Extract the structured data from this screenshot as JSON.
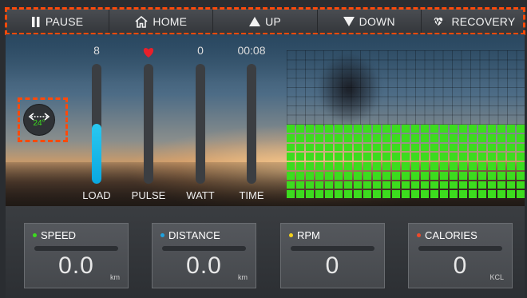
{
  "toolbar": {
    "pause_label": "PAUSE",
    "home_label": "HOME",
    "up_label": "UP",
    "down_label": "DOWN",
    "recovery_label": "RECOVERY"
  },
  "meters": {
    "load": {
      "value": "8",
      "label": "LOAD",
      "level": 0.5
    },
    "pulse": {
      "label": "PULSE"
    },
    "watt": {
      "value": "0",
      "label": "WATT"
    },
    "time": {
      "value": "00:08",
      "label": "TIME"
    }
  },
  "incline": {
    "value": "24°"
  },
  "stats": {
    "speed": {
      "label": "SPEED",
      "value": "0.0",
      "unit": "km",
      "dot_color": "#3cdc1e"
    },
    "distance": {
      "label": "DISTANCE",
      "value": "0.0",
      "unit": "km",
      "dot_color": "#1fa3e0"
    },
    "rpm": {
      "label": "RPM",
      "value": "0",
      "unit": "",
      "dot_color": "#f5d21a"
    },
    "calories": {
      "label": "CALORIES",
      "value": "0",
      "unit": "KCL",
      "dot_color": "#f04a2a"
    }
  },
  "colors": {
    "accent_green": "#3cdc1e",
    "accent_blue": "#2ac8f0",
    "highlight_dash": "#ff4a0a",
    "heart": "#e8202a"
  },
  "icons": [
    "pause-icon",
    "home-icon",
    "up-triangle-icon",
    "down-triangle-icon",
    "heart-pulse-icon",
    "heart-icon",
    "incline-arrows-icon"
  ]
}
